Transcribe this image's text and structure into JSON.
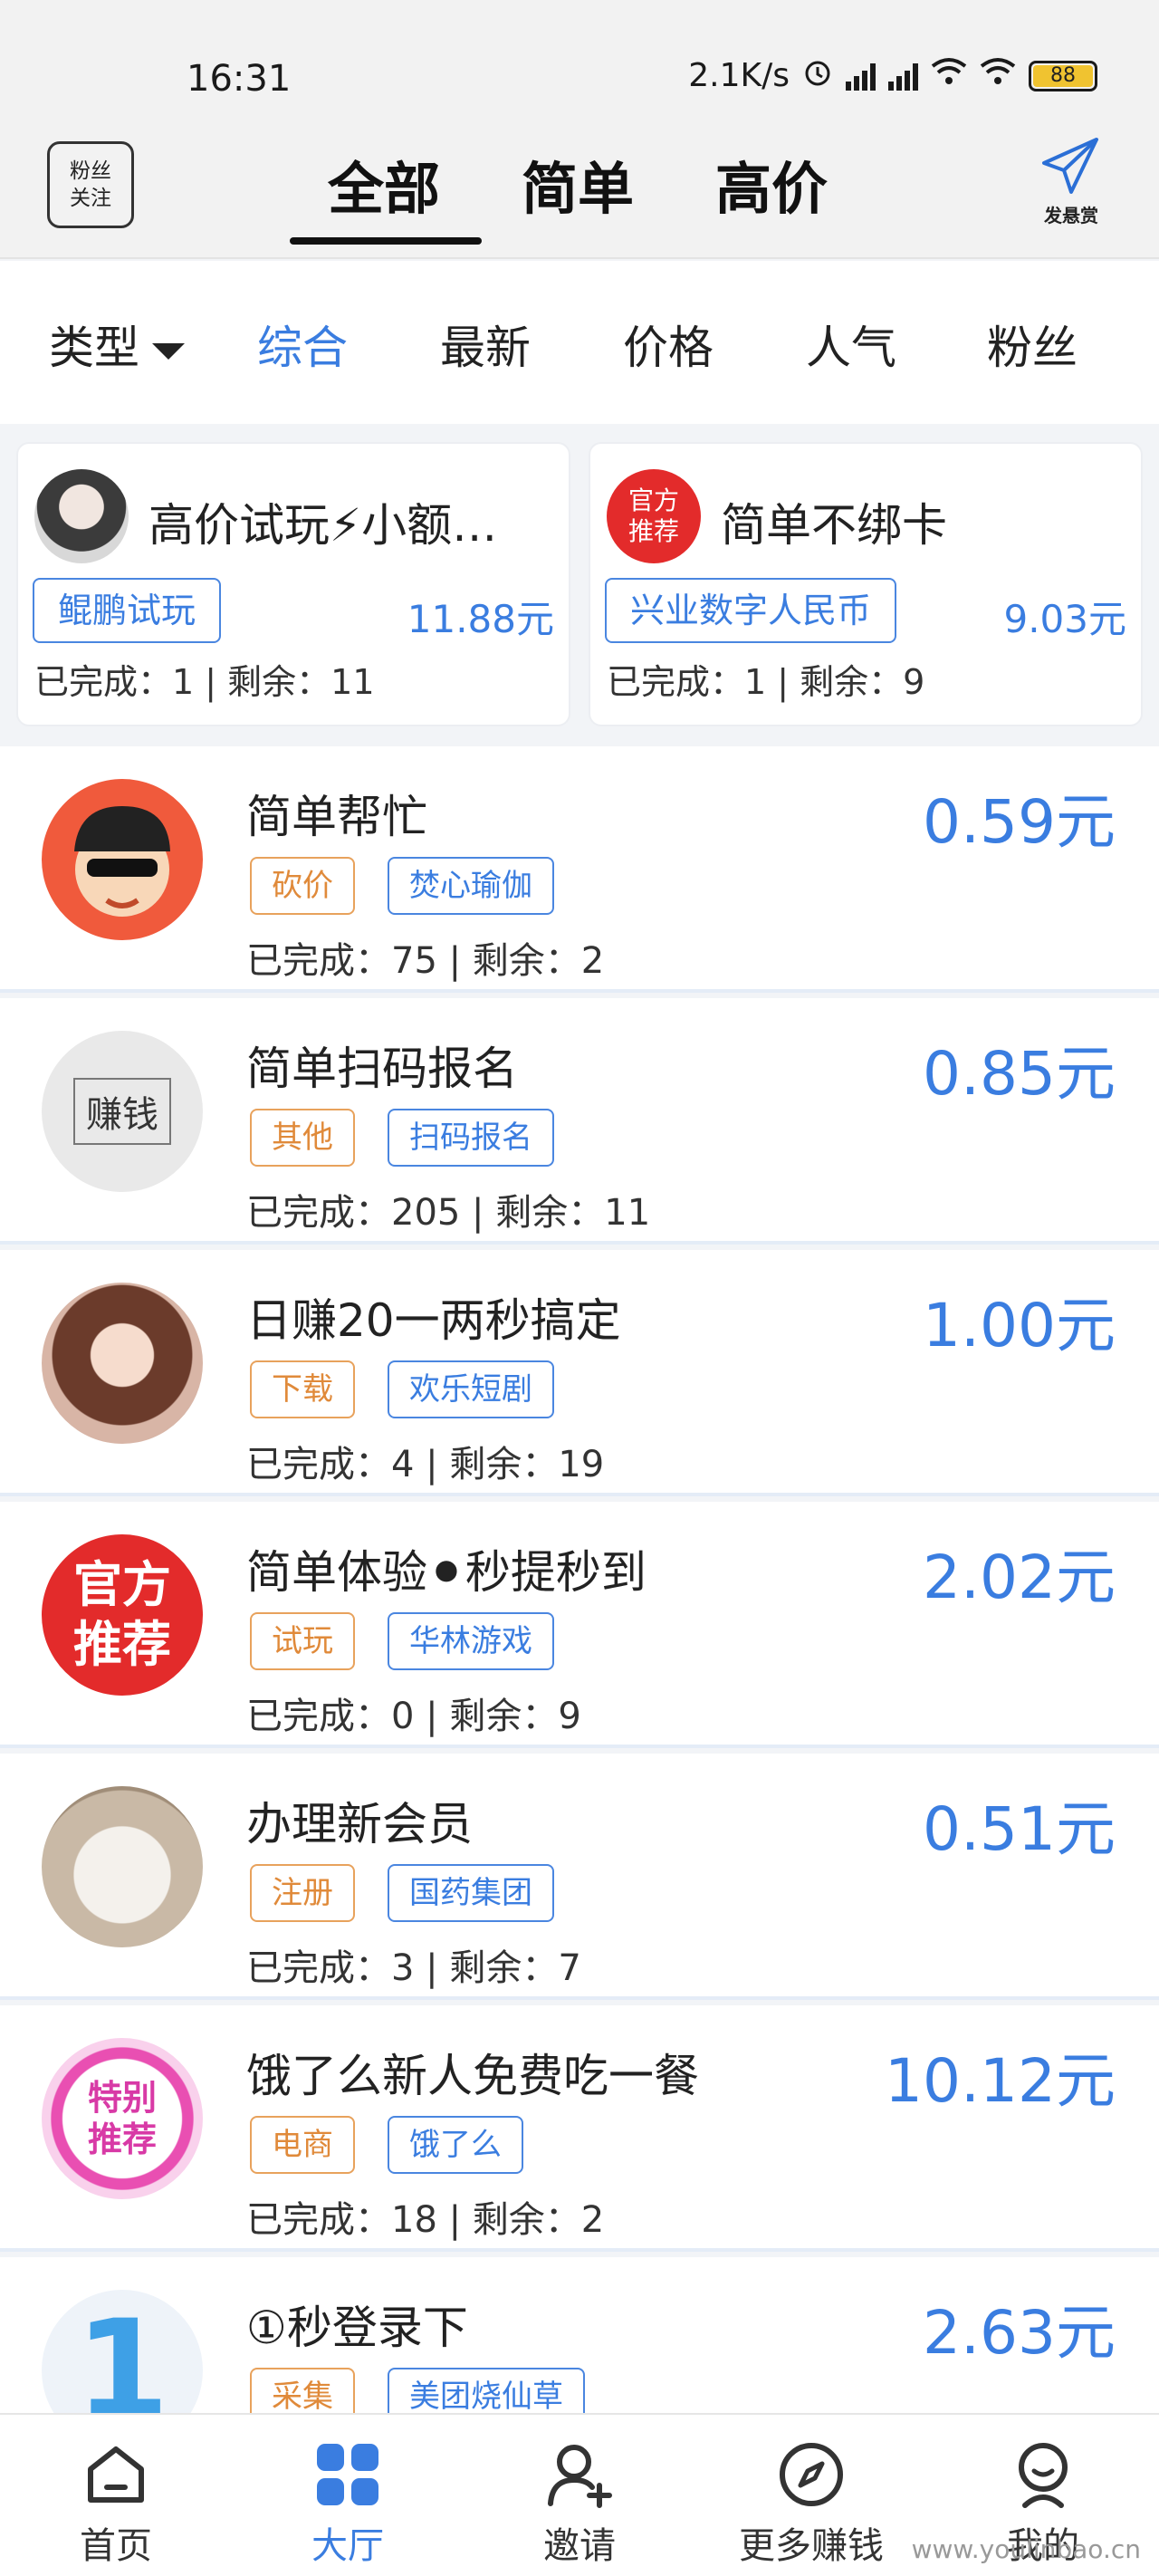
{
  "status_bar": {
    "time": "16:31",
    "net_speed": "2.1K/s",
    "battery": "88"
  },
  "header": {
    "fans_follow": [
      "粉丝",
      "关注"
    ],
    "tabs": [
      "全部",
      "简单",
      "高价"
    ],
    "active_tab": "全部",
    "post_reward": "发悬赏"
  },
  "filters": {
    "type_label": "类型",
    "items": [
      "综合",
      "最新",
      "价格",
      "人气",
      "粉丝"
    ],
    "active": "综合"
  },
  "featured": [
    {
      "title": "高价试玩⚡小额…",
      "tag": "鲲鹏试玩",
      "price": "11.88元",
      "progress": "已完成：1 | 剩余：11"
    },
    {
      "badge": [
        "官方",
        "推荐"
      ],
      "title": "简单不绑卡",
      "tag": "兴业数字人民币",
      "price": "9.03元",
      "progress": "已完成：1 | 剩余：9"
    }
  ],
  "tasks": [
    {
      "title": "简单帮忙",
      "price": "0.59元",
      "type": "砍价",
      "merchant": "焚心瑜伽",
      "progress": "已完成：75 | 剩余：2"
    },
    {
      "title": "简单扫码报名",
      "price": "0.85元",
      "type": "其他",
      "merchant": "扫码报名",
      "progress": "已完成：205 | 剩余：11",
      "avatar_text": "赚钱"
    },
    {
      "title": "日赚20一两秒搞定",
      "price": "1.00元",
      "type": "下载",
      "merchant": "欢乐短剧",
      "progress": "已完成：4 | 剩余：19"
    },
    {
      "title": "简单体验⚫秒提秒到",
      "price": "2.02元",
      "type": "试玩",
      "merchant": "华林游戏",
      "progress": "已完成：0 | 剩余：9",
      "avatar_text": [
        "官方",
        "推荐"
      ]
    },
    {
      "title": "办理新会员",
      "price": "0.51元",
      "type": "注册",
      "merchant": "国药集团",
      "progress": "已完成：3 | 剩余：7"
    },
    {
      "title": "饿了么新人免费吃一餐",
      "price": "10.12元",
      "type": "电商",
      "merchant": "饿了么",
      "progress": "已完成：18 | 剩余：2",
      "avatar_text": [
        "特别",
        "推荐"
      ]
    },
    {
      "title": "①秒登录下",
      "price": "2.63元",
      "type": "采集",
      "merchant": "美团烧仙草",
      "progress": "",
      "avatar_text": "1"
    }
  ],
  "bottom_nav": [
    {
      "label": "首页",
      "icon": "home-icon"
    },
    {
      "label": "大厅",
      "icon": "grid-icon"
    },
    {
      "label": "邀请",
      "icon": "add-user-icon"
    },
    {
      "label": "更多赚钱",
      "icon": "compass-icon"
    },
    {
      "label": "我的",
      "icon": "profile-icon"
    }
  ],
  "watermark": "www.youlinbao.cn",
  "colors": {
    "accent": "#3a7de0",
    "tag_orange": "#e08a3a",
    "official_red": "#e32b2b"
  }
}
